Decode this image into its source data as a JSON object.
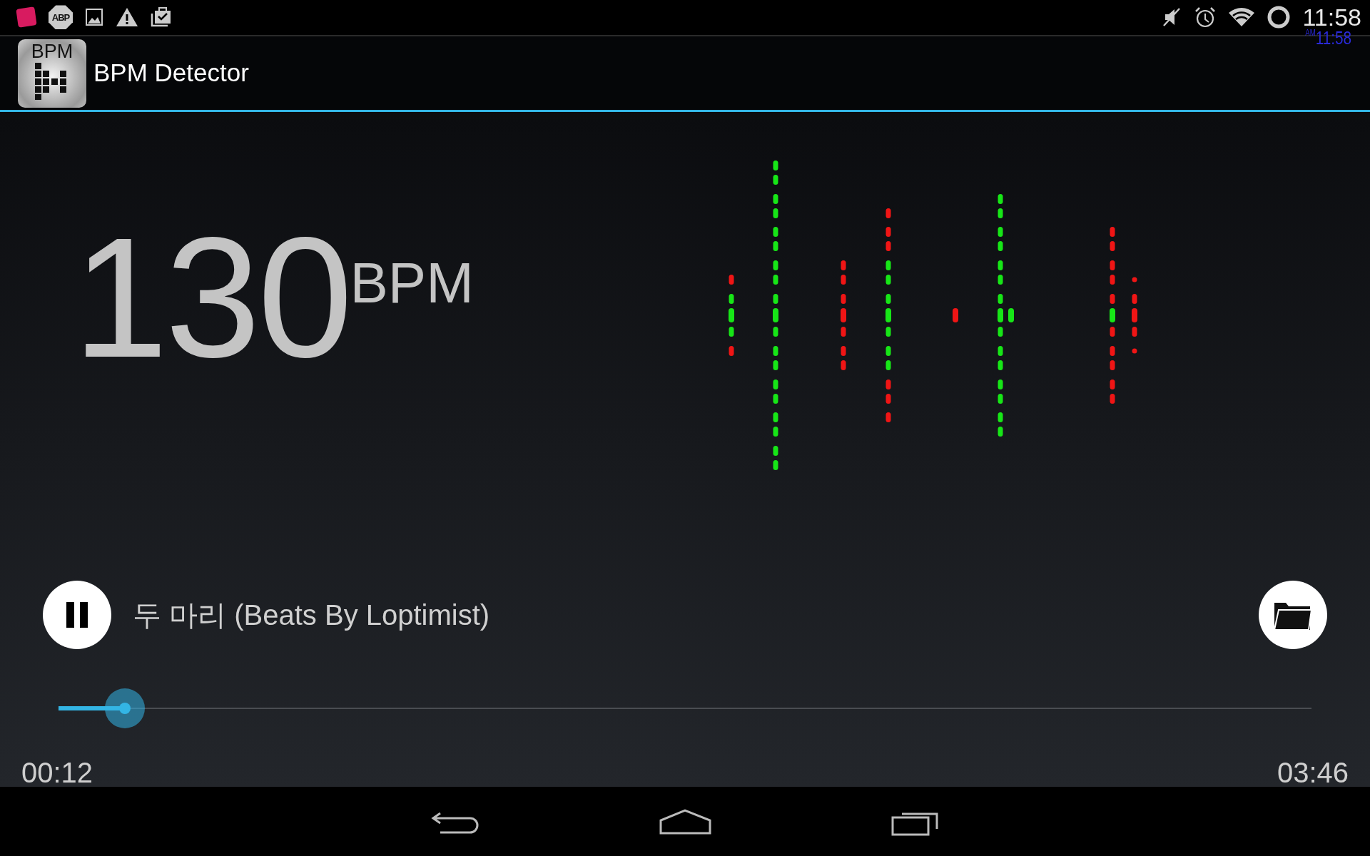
{
  "status_bar": {
    "adblock_badge": "ABP",
    "time": "11:58"
  },
  "clock_overlay": {
    "meridiem": "AM",
    "time": "11:58"
  },
  "app_bar": {
    "icon_text": "BPM",
    "title": "BPM Detector"
  },
  "tempo": {
    "value": "130",
    "unit": "BPM"
  },
  "player": {
    "playing": true,
    "track_title": "두 마리 (Beats By Loptimist)"
  },
  "progress": {
    "level": 0.053,
    "elapsed": "00:12",
    "duration": "03:46"
  }
}
